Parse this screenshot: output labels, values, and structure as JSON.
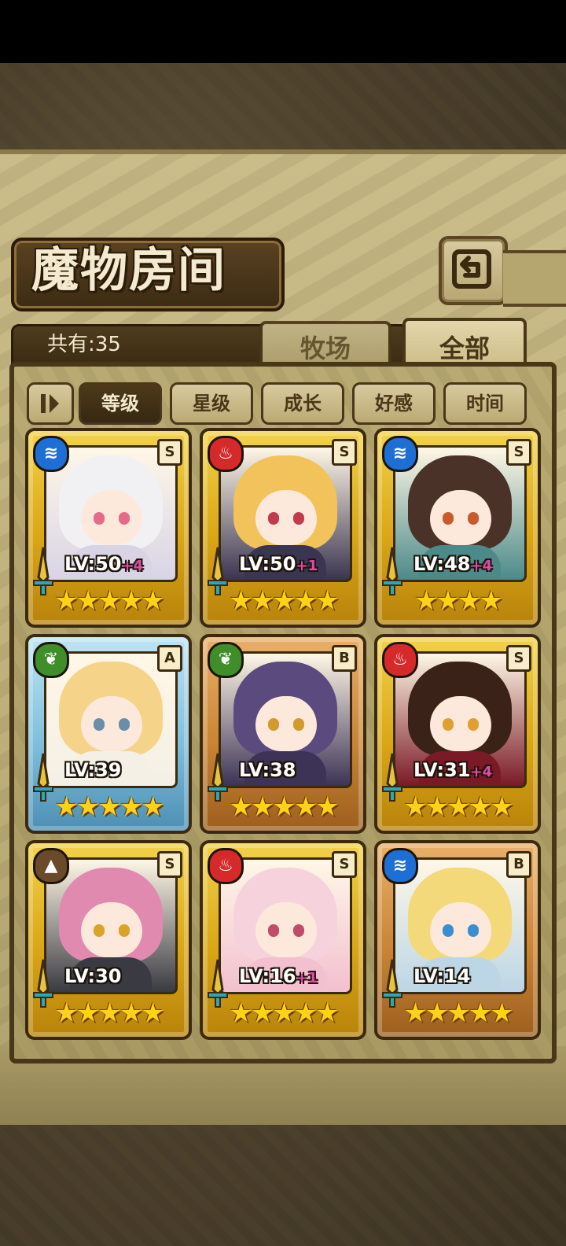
{
  "header": {
    "title": "魔物房间",
    "back_icon": "back-arrow-icon"
  },
  "count_label": "共有:35",
  "tabs": [
    {
      "label": "牧场",
      "active": false
    },
    {
      "label": "全部",
      "active": true
    }
  ],
  "sort_buttons": [
    {
      "label": "等级",
      "active": true
    },
    {
      "label": "星级",
      "active": false
    },
    {
      "label": "成长",
      "active": false
    },
    {
      "label": "好感",
      "active": false
    },
    {
      "label": "时间",
      "active": false
    }
  ],
  "monsters": [
    {
      "level": "LV:50",
      "bonus": "+4",
      "rank": "S",
      "element": "water",
      "frame": "gold",
      "stars": "★★★★★",
      "palette": {
        "hair": "#f1f1f4",
        "body": "#d8d4e6",
        "eyes": "#e56a8a"
      }
    },
    {
      "level": "LV:50",
      "bonus": "+1",
      "rank": "S",
      "element": "fire",
      "frame": "gold",
      "stars": "★★★★★",
      "palette": {
        "hair": "#f2c35a",
        "body": "#3a3550",
        "eyes": "#c23b4a"
      }
    },
    {
      "level": "LV:48",
      "bonus": "+4",
      "rank": "S",
      "element": "water",
      "frame": "gold",
      "stars": "★★★★",
      "palette": {
        "hair": "#4a3228",
        "body": "#4c8a8a",
        "eyes": "#c85a2e"
      }
    },
    {
      "level": "LV:39",
      "bonus": "",
      "rank": "A",
      "element": "wind",
      "frame": "blue",
      "stars": "★★★★★",
      "palette": {
        "hair": "#f5d48a",
        "body": "#f4f0e6",
        "eyes": "#6a8ea8"
      }
    },
    {
      "level": "LV:38",
      "bonus": "",
      "rank": "B",
      "element": "wind",
      "frame": "bronze",
      "stars": "★★★★★",
      "palette": {
        "hair": "#5a4a7e",
        "body": "#3c3356",
        "eyes": "#d29a2a"
      }
    },
    {
      "level": "LV:31",
      "bonus": "+4",
      "rank": "S",
      "element": "fire",
      "frame": "gold",
      "stars": "★★★★★",
      "palette": {
        "hair": "#3a2218",
        "body": "#7a1a26",
        "eyes": "#e0a030"
      }
    },
    {
      "level": "LV:30",
      "bonus": "",
      "rank": "S",
      "element": "earth",
      "frame": "gold",
      "stars": "★★★★★",
      "palette": {
        "hair": "#e08ab0",
        "body": "#3a3a42",
        "eyes": "#d8a42a"
      }
    },
    {
      "level": "LV:16",
      "bonus": "+1",
      "rank": "S",
      "element": "fire",
      "frame": "gold",
      "stars": "★★★★★",
      "palette": {
        "hair": "#f6d3dc",
        "body": "#f2c0cf",
        "eyes": "#c24a6a"
      }
    },
    {
      "level": "LV:14",
      "bonus": "",
      "rank": "B",
      "element": "water",
      "frame": "bronze",
      "stars": "★★★★★",
      "palette": {
        "hair": "#f4d97a",
        "body": "#bcd6e6",
        "eyes": "#3a8ed0"
      }
    }
  ],
  "element_colors": {
    "water": "#1d6fd6",
    "fire": "#d62a2a",
    "wind": "#3f8e2a",
    "earth": "#6b4a2a"
  },
  "element_glyphs": {
    "water": "≋",
    "fire": "♨",
    "wind": "❦",
    "earth": "▲"
  }
}
